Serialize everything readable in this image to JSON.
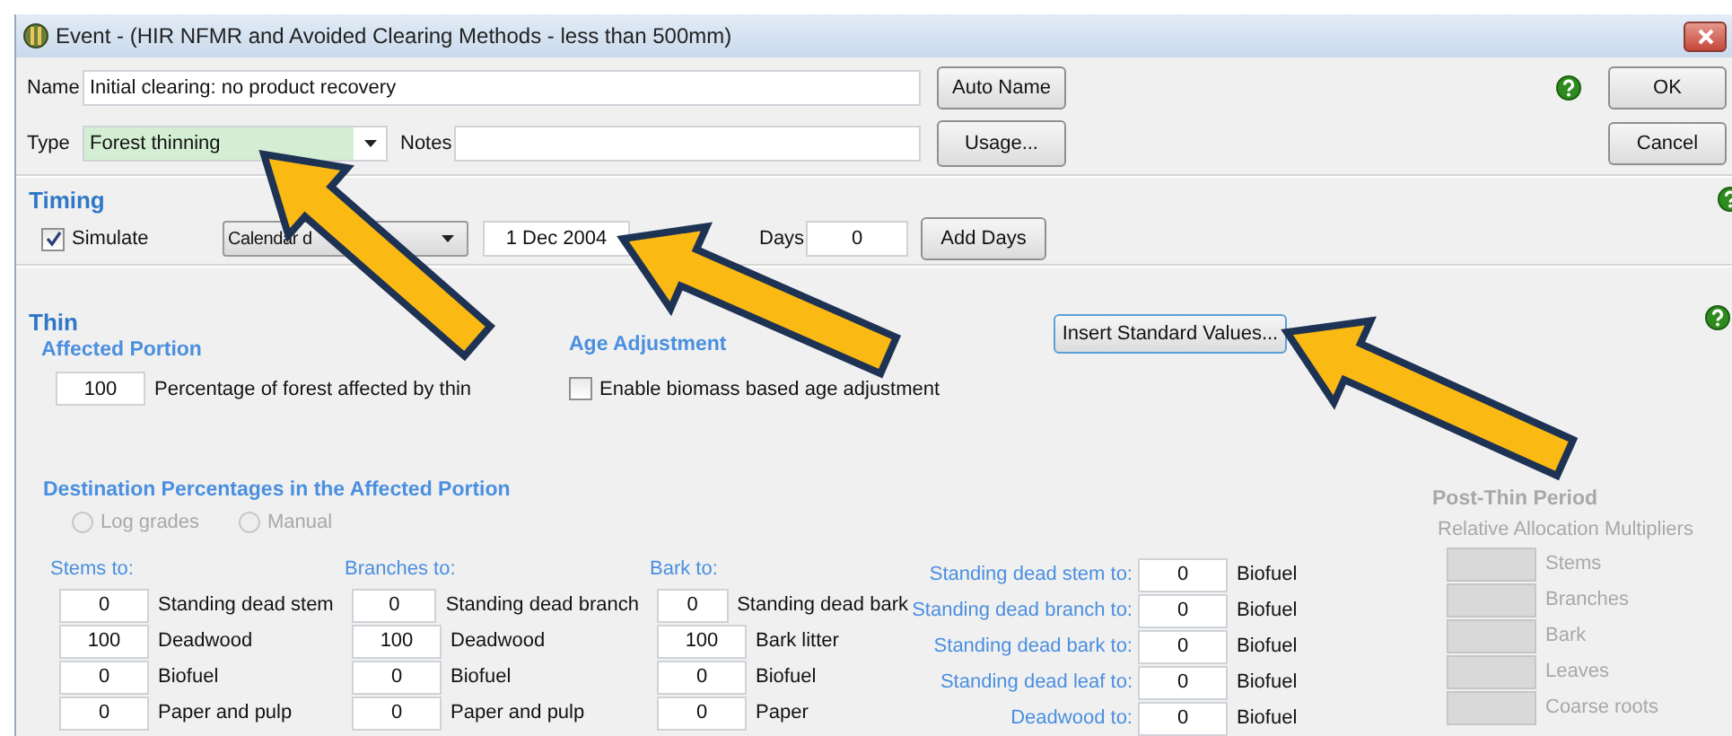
{
  "window": {
    "title": "Event -  (HIR NFMR and Avoided Clearing Methods - less than 500mm)"
  },
  "name_field": {
    "label": "Name",
    "value": "Initial clearing: no product recovery"
  },
  "type_field": {
    "label": "Type",
    "value": "Forest thinning",
    "callout": true
  },
  "notes_field": {
    "label": "Notes"
  },
  "side_buttons": [
    "Auto Name",
    "Usage..."
  ],
  "dialog_buttons": [
    "OK",
    "Cancel"
  ],
  "timing": {
    "title": "Timing",
    "simulate": {
      "label": "Simulate",
      "checked": true
    },
    "date_mode": "Calendar d",
    "date": {
      "value": "1 Dec 2004",
      "callout": true
    },
    "days_label": "Days",
    "days": "0",
    "add_days": "Add Days"
  },
  "thin": {
    "title": "Thin",
    "affected_portion": {
      "title": "Affected Portion",
      "value": "100",
      "label": "Percentage of forest affected by thin"
    },
    "age_adjustment": {
      "title": "Age Adjustment",
      "label": "Enable biomass based age adjustment",
      "checked": false
    },
    "insert_button": {
      "label": "Insert Standard Values...",
      "callout": true
    },
    "destination": {
      "title": "Destination Percentages in the Affected Portion",
      "radios": [
        {
          "label": "Log grades",
          "selected": false,
          "disabled": true
        },
        {
          "label": "Manual",
          "selected": false,
          "disabled": true
        }
      ],
      "columns": [
        {
          "heading": "Stems to:",
          "rows": [
            {
              "value": "0",
              "label": "Standing dead stem"
            },
            {
              "value": "100",
              "label": "Deadwood"
            },
            {
              "value": "0",
              "label": "Biofuel"
            },
            {
              "value": "0",
              "label": "Paper and pulp"
            }
          ]
        },
        {
          "heading": "Branches to:",
          "rows": [
            {
              "value": "0",
              "label": "Standing dead branch"
            },
            {
              "value": "100",
              "label": "Deadwood"
            },
            {
              "value": "0",
              "label": "Biofuel"
            },
            {
              "value": "0",
              "label": "Paper and pulp"
            }
          ]
        },
        {
          "heading": "Bark to:",
          "rows": [
            {
              "value": "0",
              "label": "Standing dead bark"
            },
            {
              "value": "100",
              "label": "Bark litter"
            },
            {
              "value": "0",
              "label": "Biofuel"
            },
            {
              "value": "0",
              "label": "Paper"
            }
          ]
        }
      ],
      "standing_dead": [
        {
          "label": "Standing dead stem to:",
          "value": "0",
          "target": "Biofuel"
        },
        {
          "label": "Standing dead branch to:",
          "value": "0",
          "target": "Biofuel"
        },
        {
          "label": "Standing dead bark to:",
          "value": "0",
          "target": "Biofuel"
        },
        {
          "label": "Standing dead leaf to:",
          "value": "0",
          "target": "Biofuel"
        },
        {
          "label": "Deadwood to:",
          "value": "0",
          "target": "Biofuel"
        }
      ]
    },
    "post_thin": {
      "title": "Post-Thin Period",
      "subtitle": "Relative Allocation Multipliers",
      "disabled": true,
      "items": [
        "Stems",
        "Branches",
        "Bark",
        "Leaves",
        "Coarse roots"
      ]
    }
  }
}
